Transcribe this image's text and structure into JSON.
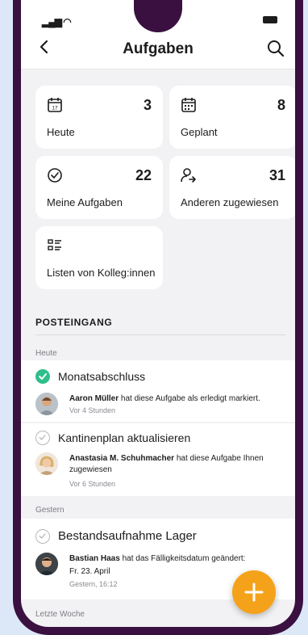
{
  "header": {
    "title": "Aufgaben",
    "back_icon": "chevron-left-icon",
    "search_icon": "search-icon"
  },
  "tiles": [
    {
      "icon": "calendar-day-icon",
      "count": "3",
      "label": "Heute"
    },
    {
      "icon": "calendar-planned-icon",
      "count": "8",
      "label": "Geplant"
    },
    {
      "icon": "check-circle-icon",
      "count": "22",
      "label": "Meine Aufgaben"
    },
    {
      "icon": "user-assigned-icon",
      "count": "31",
      "label": "Anderen zugewiesen"
    },
    {
      "icon": "list-icon",
      "label": "Listen von Kolleg:innen"
    }
  ],
  "tile_icon_day_text": "17",
  "inbox": {
    "title": "POSTEINGANG",
    "groups": {
      "today": "Heute",
      "yesterday": "Gestern",
      "last_week": "Letzte Woche"
    },
    "items": [
      {
        "title": "Monatsabschluss",
        "done": true,
        "user": "Aaron Müller",
        "message": "hat diese Aufgabe als erledigt markiert.",
        "time": "Vor 4 Stunden"
      },
      {
        "title": "Kantinenplan aktualisieren",
        "done": false,
        "user": "Anastasia M. Schuhmacher",
        "message": "hat diese Aufgabe Ihnen zugewiesen",
        "time": "Vor 6 Stunden"
      },
      {
        "title": "Bestandsaufnahme Lager",
        "done": false,
        "user": "Bastian Haas",
        "message": "hat das Fälligkeitsdatum geändert:",
        "detail": "Fr. 23. April",
        "time": "Gestern, 16:12"
      }
    ]
  },
  "fab": {
    "label": "+",
    "icon": "plus-icon"
  },
  "colors": {
    "frame": "#3a1040",
    "accent_done": "#2fbf8a",
    "fab": "#f5a21b",
    "background": "#f2f2f4"
  }
}
